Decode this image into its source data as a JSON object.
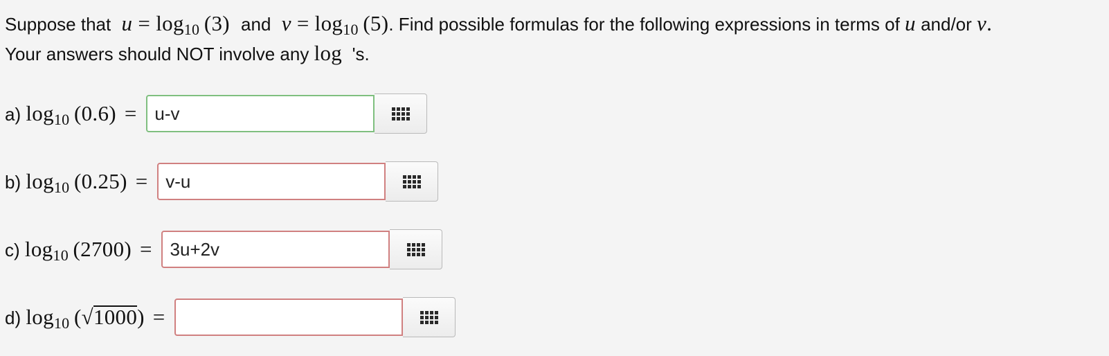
{
  "prompt": {
    "t1": "Suppose that",
    "u": "u",
    "eq1": " = ",
    "log": "log",
    "base": "10",
    "arg_u": "(3)",
    "t2": "and",
    "v": "v",
    "eq2": " = ",
    "arg_v": "(5)",
    "t3": ". Find possible formulas for the following expressions in terms of",
    "t4": "and/or",
    "t5": ".",
    "line2_a": "Your answers should NOT involve any",
    "line2_log": "log",
    "line2_b": "'s."
  },
  "questions": [
    {
      "letter": "a)",
      "log": "log",
      "base": "10",
      "arg": "(0.6)",
      "eq": "=",
      "answer": "u-v",
      "status": "correct"
    },
    {
      "letter": "b)",
      "log": "log",
      "base": "10",
      "arg": "(0.25)",
      "eq": "=",
      "answer": "v-u",
      "status": "incorrect"
    },
    {
      "letter": "c)",
      "log": "log",
      "base": "10",
      "arg": "(2700)",
      "eq": "=",
      "answer": "3u+2v",
      "status": "incorrect"
    },
    {
      "letter": "d)",
      "log": "log",
      "base": "10",
      "arg_open": "(",
      "sqrt": "√",
      "radicand": "1000",
      "arg_close": ")",
      "eq": "=",
      "answer": "",
      "status": "incorrect"
    }
  ],
  "palette_icon": "equation-palette-grid-icon",
  "colors": {
    "correct_border": "#7fbf7f",
    "incorrect_border": "#d08080",
    "background": "#f4f4f4"
  }
}
